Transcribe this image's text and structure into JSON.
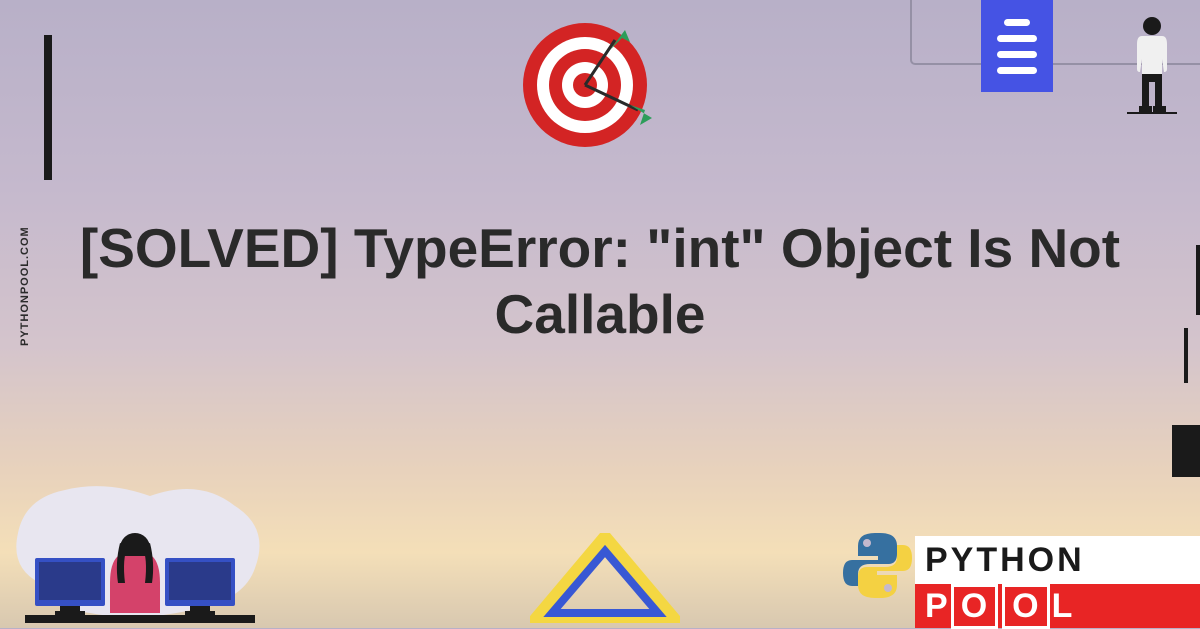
{
  "title": "[SOLVED] TypeError: \"int\" Object Is Not Callable",
  "website": "PYTHONPOOL.COM",
  "logo": {
    "line1": "PYTHON",
    "line2_p": "P",
    "line2_o1": "O",
    "line2_o2": "O",
    "line2_l": "L"
  }
}
